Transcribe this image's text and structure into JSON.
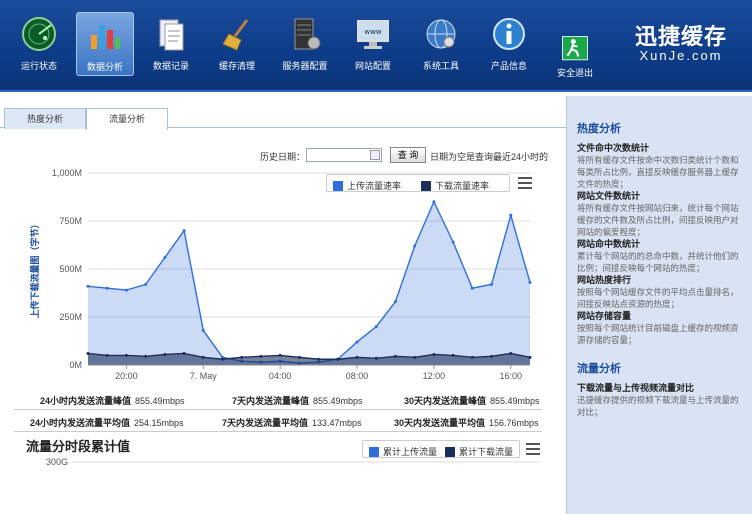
{
  "nav": {
    "items": [
      {
        "label": "运行状态",
        "icon": "radar-icon",
        "active": false
      },
      {
        "label": "数据分析",
        "icon": "bar-chart-icon",
        "active": true
      },
      {
        "label": "数据记录",
        "icon": "document-icon",
        "active": false
      },
      {
        "label": "缓存清理",
        "icon": "broom-icon",
        "active": false
      },
      {
        "label": "服务器配置",
        "icon": "server-icon",
        "active": false
      },
      {
        "label": "网站配置",
        "icon": "monitor-icon",
        "active": false
      },
      {
        "label": "系统工具",
        "icon": "globe-icon",
        "active": false
      },
      {
        "label": "产品信息",
        "icon": "info-icon",
        "active": false
      },
      {
        "label": "安全退出",
        "icon": "exit-icon",
        "active": false
      }
    ],
    "logo_cn": "迅捷缓存",
    "logo_en": "XunJe.com"
  },
  "tabs": [
    {
      "label": "热度分析",
      "active": false
    },
    {
      "label": "流量分析",
      "active": true
    }
  ],
  "query": {
    "date_label": "历史日期：",
    "date_value": "",
    "button": "查 询",
    "hint": "日期为空是查询最近24小时的"
  },
  "chart1": {
    "legend": [
      {
        "name": "上传流量速率",
        "color": "#2f6fdc"
      },
      {
        "name": "下载流量速率",
        "color": "#1c2f5c"
      }
    ]
  },
  "stats": {
    "row1": [
      {
        "label": "24小时内发送流量峰值",
        "value": "855.49mbps"
      },
      {
        "label": "7天内发送流量峰值",
        "value": "855.49mbps"
      },
      {
        "label": "30天内发送流量峰值",
        "value": "855.49mbps"
      }
    ],
    "row2": [
      {
        "label": "24小时内发送流量平均值",
        "value": "254.15mbps"
      },
      {
        "label": "7天内发送流量平均值",
        "value": "133.47mbps"
      },
      {
        "label": "30天内发送流量平均值",
        "value": "156.76mbps"
      }
    ]
  },
  "section2": {
    "title": "流量分时段累计值",
    "legend": [
      {
        "name": "累计上传流量",
        "color": "#2f6fdc"
      },
      {
        "name": "累计下载流量",
        "color": "#1c2f5c"
      }
    ]
  },
  "sidebar": {
    "heat_title": "热度分析",
    "heat_items": [
      {
        "title": "文件命中次数统计",
        "desc": "将所有缓存文件按命中次数归类统计个数和每类所占比例，直接反映缓存服务器上缓存文件的热度；"
      },
      {
        "title": "网站文件数统计",
        "desc": "将所有缓存文件按网站归来，统计每个网站缓存的文件数及所占比例，间接反映用户对网站的偏爱程度；"
      },
      {
        "title": "网站命中数统计",
        "desc": "累计每个网站的的总命中数，并统计他们的比例；间接反映每个网站的热度；"
      },
      {
        "title": "网站热度排行",
        "desc": "按照每个网站缓存文件的平均点击量排名，间接反映站点资源的热度；"
      },
      {
        "title": "网站存储容量",
        "desc": "按照每个网站统计目前磁盘上缓存的视频资源存储的容量；"
      }
    ],
    "flow_title": "流量分析",
    "flow_items": [
      {
        "title": "下载流量与上传视频流量对比",
        "desc": "迅捷缓存提供的视频下载流量与上传流量的对比；"
      }
    ]
  },
  "chart_data": [
    {
      "type": "area",
      "ylabel": "上传下载流量图（字节）",
      "x_ticks": [
        "20:00",
        "7. May",
        "04:00",
        "08:00",
        "12:00",
        "16:00"
      ],
      "y_ticks": [
        "0M",
        "250M",
        "500M",
        "750M",
        "1,000M"
      ],
      "ylim": [
        0,
        1000
      ],
      "series": [
        {
          "name": "上传流量速率",
          "x": [
            "18:00",
            "19:00",
            "20:00",
            "21:00",
            "22:00",
            "23:00",
            "7. May 00:00",
            "01:00",
            "02:00",
            "03:00",
            "04:00",
            "05:00",
            "06:00",
            "07:00",
            "08:00",
            "09:00",
            "10:00",
            "11:00",
            "12:00",
            "13:00",
            "14:00",
            "15:00",
            "16:00",
            "17:00"
          ],
          "values": [
            410,
            400,
            390,
            420,
            560,
            700,
            180,
            40,
            20,
            15,
            20,
            10,
            15,
            30,
            120,
            200,
            330,
            620,
            850,
            640,
            400,
            420,
            780,
            430
          ]
        },
        {
          "name": "下载流量速率",
          "x": [
            "18:00",
            "19:00",
            "20:00",
            "21:00",
            "22:00",
            "23:00",
            "7. May 00:00",
            "01:00",
            "02:00",
            "03:00",
            "04:00",
            "05:00",
            "06:00",
            "07:00",
            "08:00",
            "09:00",
            "10:00",
            "11:00",
            "12:00",
            "13:00",
            "14:00",
            "15:00",
            "16:00",
            "17:00"
          ],
          "values": [
            60,
            50,
            50,
            45,
            55,
            60,
            40,
            30,
            40,
            45,
            50,
            40,
            30,
            30,
            40,
            35,
            45,
            40,
            55,
            50,
            40,
            45,
            60,
            40
          ]
        }
      ]
    },
    {
      "type": "bar",
      "y_ticks": [
        "300G"
      ],
      "ylim": [
        0,
        300
      ],
      "series": [
        {
          "name": "累计上传流量"
        },
        {
          "name": "累计下载流量"
        }
      ]
    }
  ]
}
